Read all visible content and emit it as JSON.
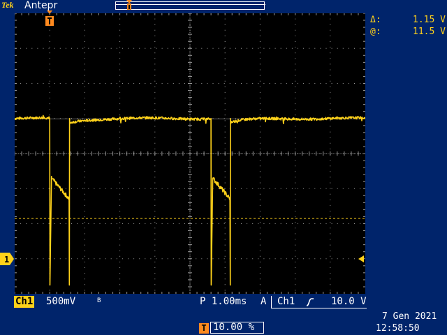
{
  "header": {
    "logo_text": "Tek",
    "mode": "Antepr"
  },
  "cursor": {
    "delta_label": "Δ:",
    "delta_value": "1.15 V",
    "at_label": "@:",
    "at_value": "11.5 V"
  },
  "channel": {
    "name": "Ch1",
    "volts_per_div": "500mV",
    "bw_limit": "B",
    "marker": "1"
  },
  "horizontal": {
    "label": "P",
    "time_per_div": "1.00ms"
  },
  "trigger": {
    "mode_label": "A",
    "source": "Ch1",
    "slope": "rising-slope-icon",
    "level": "10.0 V",
    "marker_letter": "T",
    "position_percent": "10.00 %"
  },
  "datetime": {
    "date": "7 Gen  2021",
    "time": "12:58:50"
  },
  "colors": {
    "trace": "#ffd21a",
    "trigger": "#ff8a1f",
    "background": "#00246b",
    "screen": "#000000",
    "grid": "#9a9a9a"
  },
  "grid": {
    "h_divisions": 10,
    "v_divisions": 8
  },
  "waveform": {
    "units": "divisions",
    "baseline_level": 5.0,
    "low_level_start": 3.3,
    "low_level_end": 2.7,
    "pulses": [
      {
        "fall_div": 1.0,
        "low_start": 1.05,
        "rise_div": 1.56
      },
      {
        "fall_div": 5.6,
        "low_start": 5.65,
        "rise_div": 6.15
      }
    ],
    "dashed_reference_level": 2.15
  }
}
